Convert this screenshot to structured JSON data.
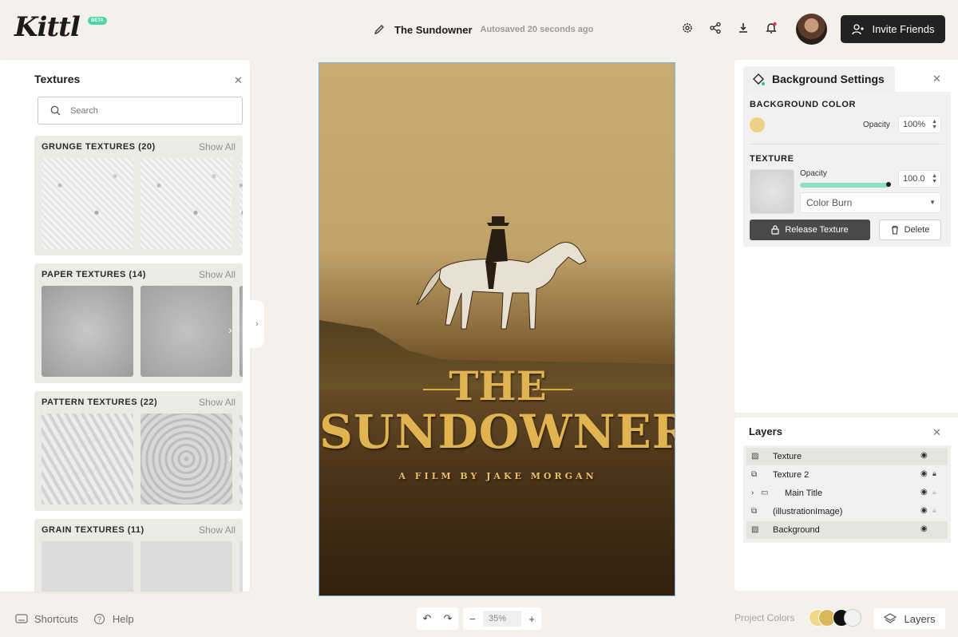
{
  "app": {
    "logo": "Kittl",
    "beta": "BETA"
  },
  "header": {
    "doc_title": "The Sundowner",
    "autosave": "Autosaved 20 seconds ago",
    "invite_label": "Invite Friends",
    "icons": [
      "gear-icon",
      "share-icon",
      "download-icon",
      "bell-icon"
    ]
  },
  "textures_panel": {
    "title": "Textures",
    "search_placeholder": "Search",
    "categories": [
      {
        "title": "GRUNGE TEXTURES (20)",
        "show_all": "Show All"
      },
      {
        "title": "PAPER TEXTURES (14)",
        "show_all": "Show All"
      },
      {
        "title": "PATTERN TEXTURES (22)",
        "show_all": "Show All"
      },
      {
        "title": "GRAIN TEXTURES (11)",
        "show_all": "Show All"
      }
    ]
  },
  "canvas": {
    "title_the": "THE",
    "title_main": "SUNDOWNER",
    "subtitle": "A FILM BY JAKE MORGAN"
  },
  "background_settings": {
    "title": "Background Settings",
    "bg_color_label": "BACKGROUND COLOR",
    "bg_color": "#ecd084",
    "opacity_label": "Opacity",
    "bg_opacity": "100%",
    "texture_label": "TEXTURE",
    "texture_opacity_label": "Opacity",
    "texture_opacity": "100.0",
    "texture_opacity_level": 1.0,
    "blend_mode": "Color Burn",
    "release_label": "Release Texture",
    "delete_label": "Delete"
  },
  "layers": {
    "title": "Layers",
    "items": [
      {
        "name": "Texture",
        "selected": true
      },
      {
        "name": "Texture 2",
        "selected": false
      },
      {
        "name": "Main Title",
        "selected": false
      },
      {
        "name": "(illustrationImage)",
        "selected": false
      },
      {
        "name": "Background",
        "selected": true
      }
    ]
  },
  "footer": {
    "shortcuts": "Shortcuts",
    "help": "Help",
    "zoom": "35%",
    "project_colors": "Project Colors",
    "project_color_swatches": [
      "#f0d88a",
      "#d9b85a",
      "#111111",
      "#f2f2f2"
    ],
    "layers_button": "Layers"
  }
}
